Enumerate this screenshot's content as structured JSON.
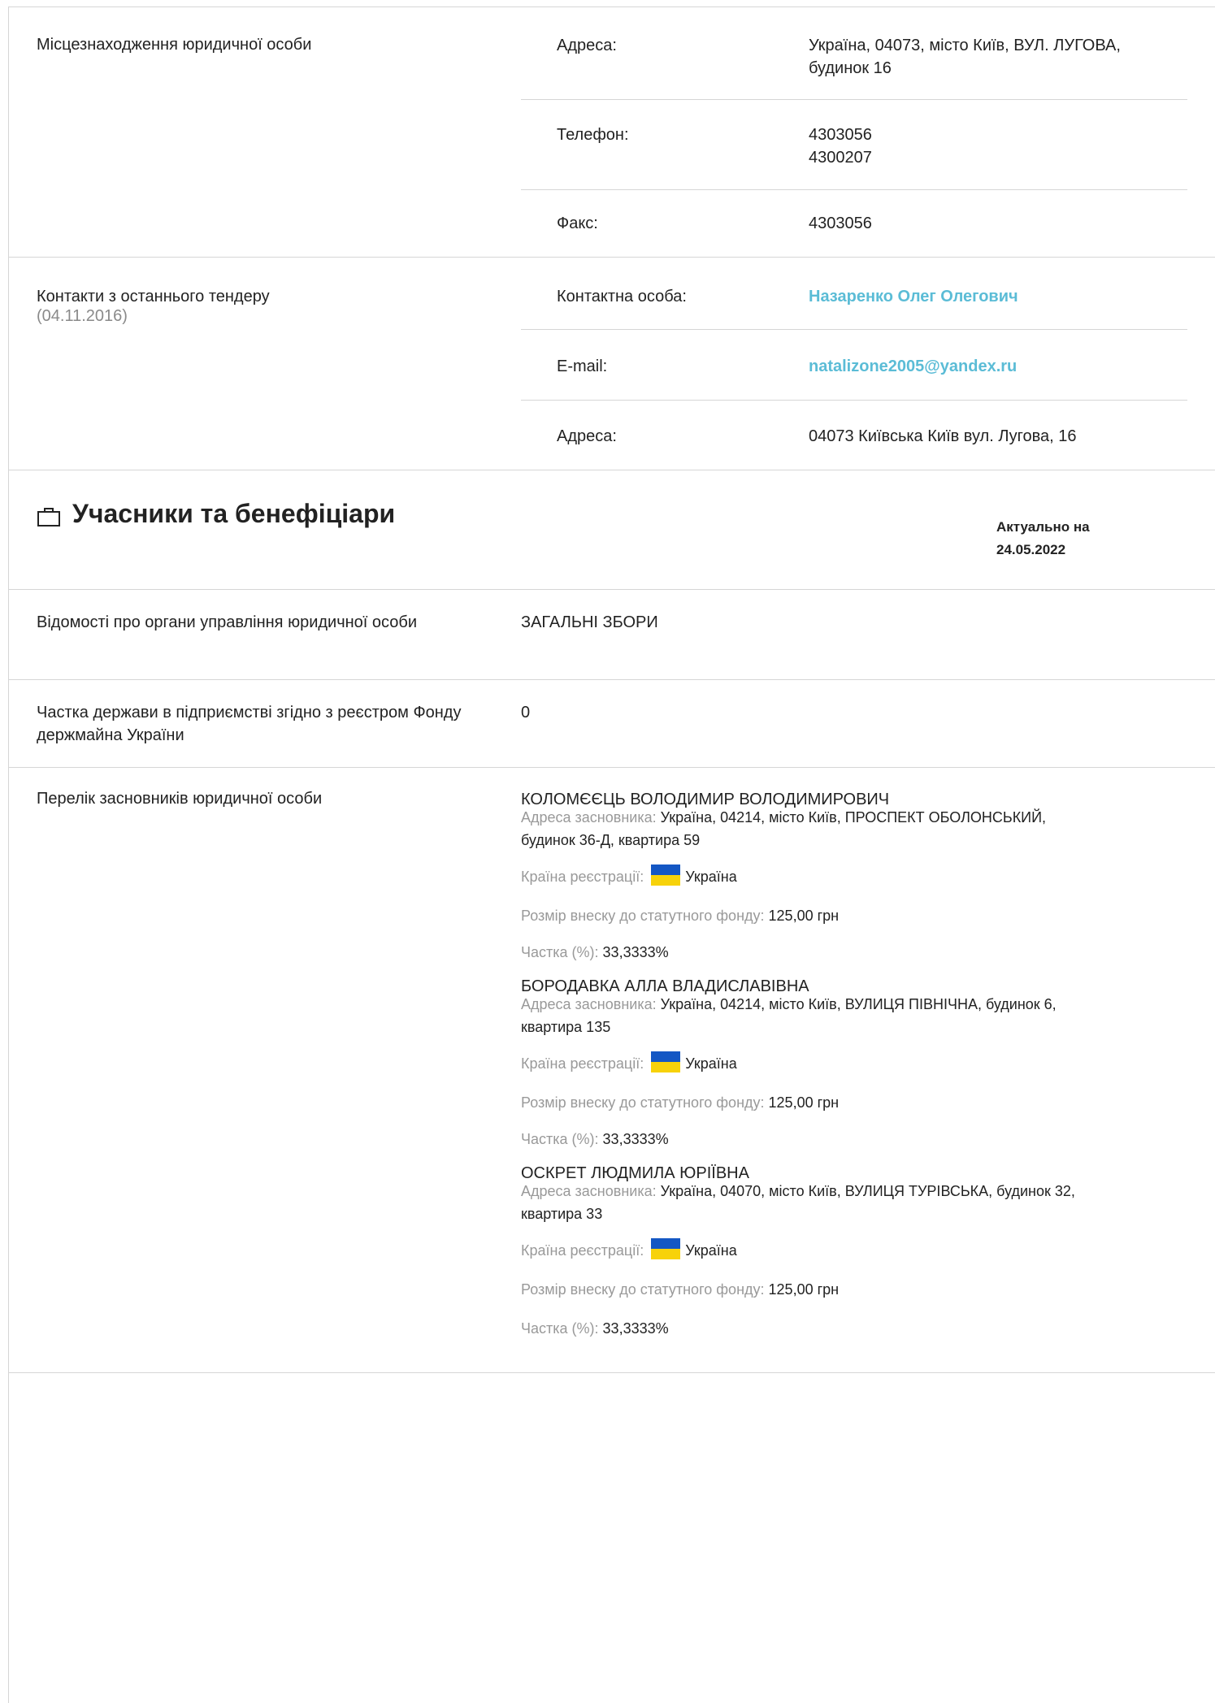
{
  "location": {
    "label": "Місцезнаходження юридичної особи",
    "rows": [
      {
        "key": "Адреса:",
        "value": "Україна, 04073, місто Київ, ВУЛ. ЛУГОВА, будинок 16"
      },
      {
        "key": "Телефон:",
        "value_lines": [
          "4303056",
          "4300207"
        ]
      },
      {
        "key": "Факс:",
        "value": "4303056"
      }
    ]
  },
  "contacts": {
    "label": "Контакти з останнього тендеру",
    "date": "(04.11.2016)",
    "rows": [
      {
        "key": "Контактна особа:",
        "value": "Назаренко Олег Олегович"
      },
      {
        "key": "E-mail:",
        "value": "natalizone2005@yandex.ru"
      },
      {
        "key": "Адреса:",
        "value": "04073 Київська Київ вул. Лугова, 16"
      }
    ]
  },
  "section": {
    "title": "Учасники та бенефіціари",
    "icon": "briefcase-icon",
    "actual_label": "Актуально на",
    "actual_date": "24.05.2022"
  },
  "governance": {
    "label": "Відомості про органи управління юридичної особи",
    "value": "ЗАГАЛЬНІ ЗБОРИ"
  },
  "state_share": {
    "label": "Частка держави в підприємстві згідно з реєстром Фонду держмайна України",
    "value": "0"
  },
  "founders": {
    "label": "Перелік засновників юридичної особи",
    "address_label": "Адреса засновника:",
    "country_label": "Країна реєстрації:",
    "contribution_label": "Розмір внеску до статутного фонду:",
    "share_label": "Частка (%):",
    "items": [
      {
        "name": "КОЛОМЄЄЦЬ ВОЛОДИМИР ВОЛОДИМИРОВИЧ",
        "address_line1": "Україна, 04214, місто Київ, ПРОСПЕКТ ОБОЛОНСЬКИЙ,",
        "address_line2": "будинок 36-Д, квартира 59",
        "country": "Україна",
        "contribution": "125,00 грн",
        "share": "33,3333%"
      },
      {
        "name": "БОРОДАВКА АЛЛА ВЛАДИСЛАВІВНА",
        "address_line1": "Україна, 04214, місто Київ, ВУЛИЦЯ ПІВНІЧНА, будинок 6,",
        "address_line2": "квартира 135",
        "country": "Україна",
        "contribution": "125,00 грн",
        "share": "33,3333%"
      },
      {
        "name": "ОСКРЕТ ЛЮДМИЛА ЮРІЇВНА",
        "address_line1": "Україна, 04070, місто Київ, ВУЛИЦЯ ТУРІВСЬКА, будинок 32,",
        "address_line2": "квартира 33",
        "country": "Україна",
        "contribution": "125,00 грн",
        "share": "33,3333%"
      }
    ]
  },
  "colors": {
    "link": "#5bbcd6",
    "muted": "#8a8a8a",
    "border": "#d6d6d6",
    "flag_blue": "#1457c4",
    "flag_yellow": "#f7d20a"
  }
}
